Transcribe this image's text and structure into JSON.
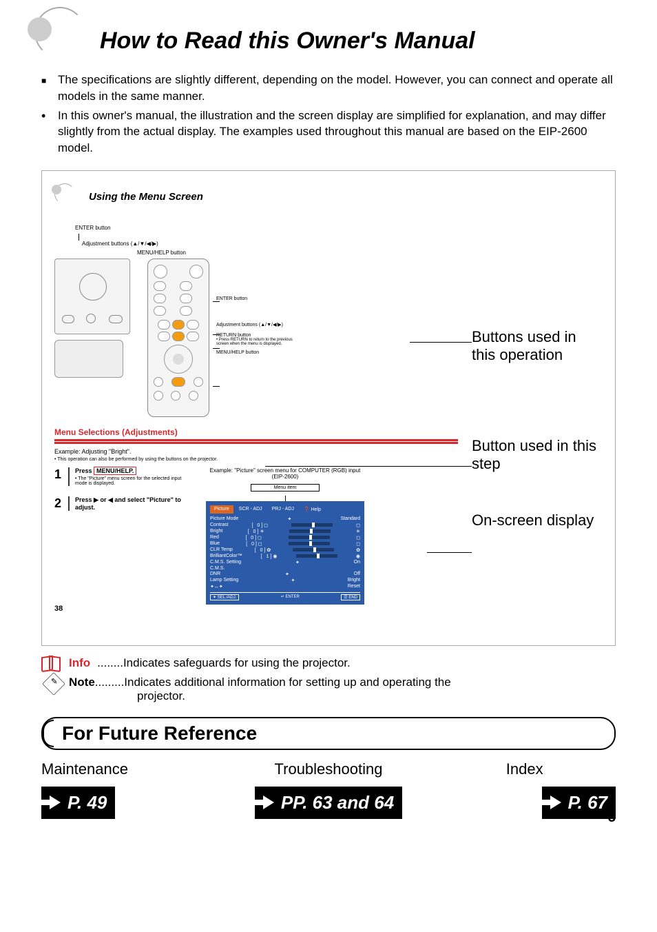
{
  "title": "How to Read this Owner's Manual",
  "intro": {
    "para1": "The specifications are slightly different, depending on the model. However, you can connect and operate all models in the same manner.",
    "para2": "In this owner's manual, the illustration and the screen display are simplified for explanation, and may differ slightly from the actual display. The examples used throughout this manual are based on the EIP-2600 model."
  },
  "example": {
    "title": "Using the Menu Screen",
    "labels": {
      "enter_btn_a": "ENTER button",
      "adj_btn_a": "Adjustment buttons (▲/▼/◀/▶)",
      "menu_help_a": "MENU/HELP button",
      "enter_btn_b": "ENTER button",
      "adj_btn_b": "Adjustment buttons (▲/▼/◀/▶)",
      "return_btn": "RETURN button",
      "return_note": "• Press RETURN to return to the previous screen when the menu is displayed.",
      "menu_help_b": "MENU/HELP button"
    },
    "red_heading": "Menu Selections (Adjustments)",
    "example_line": "Example: Adjusting \"Bright\".",
    "example_sub": "• This operation can also be performed by using the buttons on the projector.",
    "step1_pre": "Press ",
    "step1_highlight": "MENU/HELP.",
    "step1_sub": "• The \"Picture\" menu screen for the selected input mode is displayed.",
    "step2": "Press ▶ or ◀ and select \"Picture\" to adjust.",
    "menu_screen_label": "Example: \"Picture\" screen menu for COMPUTER (RGB) input (EIP-2600)",
    "menu_item_label": "Menu item",
    "osd": {
      "tab1": "Picture",
      "tab2": "SCR - ADJ",
      "tab3": "PRJ - ADJ",
      "tab4": "❓ Help",
      "picture_mode": "Picture Mode",
      "picture_mode_val": "Standard",
      "contrast": "Contrast",
      "bright": "Bright",
      "red": "Red",
      "blue": "Blue",
      "clr_temp": "CLR Temp",
      "brilliant": "BrilliantColor™",
      "cms_setting": "C.M.S. Setting",
      "cms": "C.M.S.",
      "dnr": "DNR",
      "dnr_val": "Off",
      "lamp": "Lamp Setting",
      "lamp_val": "Bright",
      "reset": "Reset",
      "on": "On",
      "sel": "SEL./ADJ.",
      "enter": "↵ ENTER",
      "end": "END"
    },
    "page_num": "38"
  },
  "annotations": {
    "buttons_used": "Buttons used in this operation",
    "button_step": "Button used in this step",
    "onscreen": "On-screen display"
  },
  "info": {
    "label": "Info",
    "text": "........Indicates safeguards for using the projector."
  },
  "note": {
    "label": "Note",
    "text_pre": ".........Indicates additional information for setting up and operating the",
    "text_post": "projector."
  },
  "future_ref": {
    "title": "For Future Reference",
    "col1_label": "Maintenance",
    "col1_page": "P. 49",
    "col2_label": "Troubleshooting",
    "col2_page": "PP. 63 and 64",
    "col3_label": "Index",
    "col3_page": "P. 67"
  },
  "page_number": "3"
}
